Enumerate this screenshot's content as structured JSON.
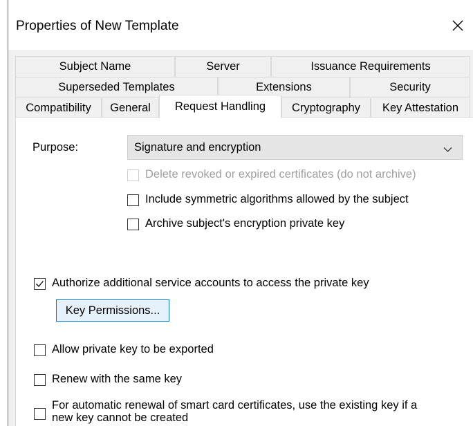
{
  "window": {
    "title": "Properties of New Template"
  },
  "tabs": {
    "row1": [
      "Subject Name",
      "Server",
      "Issuance Requirements"
    ],
    "row2": [
      "Superseded Templates",
      "Extensions",
      "Security"
    ],
    "row3": [
      "Compatibility",
      "General",
      "Request Handling",
      "Cryptography",
      "Key Attestation"
    ],
    "active": "Request Handling"
  },
  "form": {
    "purpose_label": "Purpose:",
    "purpose_value": "Signature and encryption",
    "options": [
      {
        "label": "Delete revoked or expired certificates (do not archive)",
        "checked": false,
        "enabled": false
      },
      {
        "label": "Include symmetric algorithms allowed by the subject",
        "checked": false,
        "enabled": true
      },
      {
        "label": "Archive subject's encryption private key",
        "checked": false,
        "enabled": true
      },
      {
        "label": "Authorize additional service accounts to access the private key",
        "checked": true,
        "enabled": true
      },
      {
        "label": "Allow private key to be exported",
        "checked": false,
        "enabled": true
      },
      {
        "label": "Renew with the same key",
        "checked": false,
        "enabled": true
      },
      {
        "label_line1": "For automatic renewal of smart card certificates, use the existing key if a",
        "label_line2": "new key cannot be created",
        "checked": false,
        "enabled": true
      }
    ],
    "key_permissions_button": "Key Permissions..."
  },
  "colors": {
    "accent": "#0078d7",
    "window_border": "#2b79c0",
    "dialog_background": "#f0f0f0",
    "disabled_text": "#a0a0a0"
  },
  "icons": {
    "close": "close-icon",
    "dropdown": "chevron-down-icon",
    "check": "checkmark-icon"
  }
}
